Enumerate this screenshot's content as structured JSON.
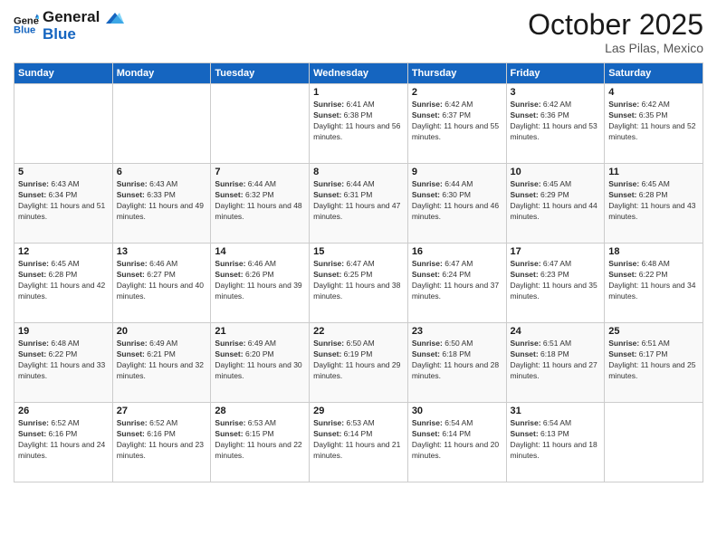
{
  "header": {
    "logo_line1": "General",
    "logo_line2": "Blue",
    "title": "October 2025",
    "subtitle": "Las Pilas, Mexico"
  },
  "calendar": {
    "days_of_week": [
      "Sunday",
      "Monday",
      "Tuesday",
      "Wednesday",
      "Thursday",
      "Friday",
      "Saturday"
    ],
    "weeks": [
      [
        {
          "day": "",
          "detail": ""
        },
        {
          "day": "",
          "detail": ""
        },
        {
          "day": "",
          "detail": ""
        },
        {
          "day": "1",
          "detail": "Sunrise: 6:41 AM\nSunset: 6:38 PM\nDaylight: 11 hours and 56 minutes."
        },
        {
          "day": "2",
          "detail": "Sunrise: 6:42 AM\nSunset: 6:37 PM\nDaylight: 11 hours and 55 minutes."
        },
        {
          "day": "3",
          "detail": "Sunrise: 6:42 AM\nSunset: 6:36 PM\nDaylight: 11 hours and 53 minutes."
        },
        {
          "day": "4",
          "detail": "Sunrise: 6:42 AM\nSunset: 6:35 PM\nDaylight: 11 hours and 52 minutes."
        }
      ],
      [
        {
          "day": "5",
          "detail": "Sunrise: 6:43 AM\nSunset: 6:34 PM\nDaylight: 11 hours and 51 minutes."
        },
        {
          "day": "6",
          "detail": "Sunrise: 6:43 AM\nSunset: 6:33 PM\nDaylight: 11 hours and 49 minutes."
        },
        {
          "day": "7",
          "detail": "Sunrise: 6:44 AM\nSunset: 6:32 PM\nDaylight: 11 hours and 48 minutes."
        },
        {
          "day": "8",
          "detail": "Sunrise: 6:44 AM\nSunset: 6:31 PM\nDaylight: 11 hours and 47 minutes."
        },
        {
          "day": "9",
          "detail": "Sunrise: 6:44 AM\nSunset: 6:30 PM\nDaylight: 11 hours and 46 minutes."
        },
        {
          "day": "10",
          "detail": "Sunrise: 6:45 AM\nSunset: 6:29 PM\nDaylight: 11 hours and 44 minutes."
        },
        {
          "day": "11",
          "detail": "Sunrise: 6:45 AM\nSunset: 6:28 PM\nDaylight: 11 hours and 43 minutes."
        }
      ],
      [
        {
          "day": "12",
          "detail": "Sunrise: 6:45 AM\nSunset: 6:28 PM\nDaylight: 11 hours and 42 minutes."
        },
        {
          "day": "13",
          "detail": "Sunrise: 6:46 AM\nSunset: 6:27 PM\nDaylight: 11 hours and 40 minutes."
        },
        {
          "day": "14",
          "detail": "Sunrise: 6:46 AM\nSunset: 6:26 PM\nDaylight: 11 hours and 39 minutes."
        },
        {
          "day": "15",
          "detail": "Sunrise: 6:47 AM\nSunset: 6:25 PM\nDaylight: 11 hours and 38 minutes."
        },
        {
          "day": "16",
          "detail": "Sunrise: 6:47 AM\nSunset: 6:24 PM\nDaylight: 11 hours and 37 minutes."
        },
        {
          "day": "17",
          "detail": "Sunrise: 6:47 AM\nSunset: 6:23 PM\nDaylight: 11 hours and 35 minutes."
        },
        {
          "day": "18",
          "detail": "Sunrise: 6:48 AM\nSunset: 6:22 PM\nDaylight: 11 hours and 34 minutes."
        }
      ],
      [
        {
          "day": "19",
          "detail": "Sunrise: 6:48 AM\nSunset: 6:22 PM\nDaylight: 11 hours and 33 minutes."
        },
        {
          "day": "20",
          "detail": "Sunrise: 6:49 AM\nSunset: 6:21 PM\nDaylight: 11 hours and 32 minutes."
        },
        {
          "day": "21",
          "detail": "Sunrise: 6:49 AM\nSunset: 6:20 PM\nDaylight: 11 hours and 30 minutes."
        },
        {
          "day": "22",
          "detail": "Sunrise: 6:50 AM\nSunset: 6:19 PM\nDaylight: 11 hours and 29 minutes."
        },
        {
          "day": "23",
          "detail": "Sunrise: 6:50 AM\nSunset: 6:18 PM\nDaylight: 11 hours and 28 minutes."
        },
        {
          "day": "24",
          "detail": "Sunrise: 6:51 AM\nSunset: 6:18 PM\nDaylight: 11 hours and 27 minutes."
        },
        {
          "day": "25",
          "detail": "Sunrise: 6:51 AM\nSunset: 6:17 PM\nDaylight: 11 hours and 25 minutes."
        }
      ],
      [
        {
          "day": "26",
          "detail": "Sunrise: 6:52 AM\nSunset: 6:16 PM\nDaylight: 11 hours and 24 minutes."
        },
        {
          "day": "27",
          "detail": "Sunrise: 6:52 AM\nSunset: 6:16 PM\nDaylight: 11 hours and 23 minutes."
        },
        {
          "day": "28",
          "detail": "Sunrise: 6:53 AM\nSunset: 6:15 PM\nDaylight: 11 hours and 22 minutes."
        },
        {
          "day": "29",
          "detail": "Sunrise: 6:53 AM\nSunset: 6:14 PM\nDaylight: 11 hours and 21 minutes."
        },
        {
          "day": "30",
          "detail": "Sunrise: 6:54 AM\nSunset: 6:14 PM\nDaylight: 11 hours and 20 minutes."
        },
        {
          "day": "31",
          "detail": "Sunrise: 6:54 AM\nSunset: 6:13 PM\nDaylight: 11 hours and 18 minutes."
        },
        {
          "day": "",
          "detail": ""
        }
      ]
    ]
  }
}
